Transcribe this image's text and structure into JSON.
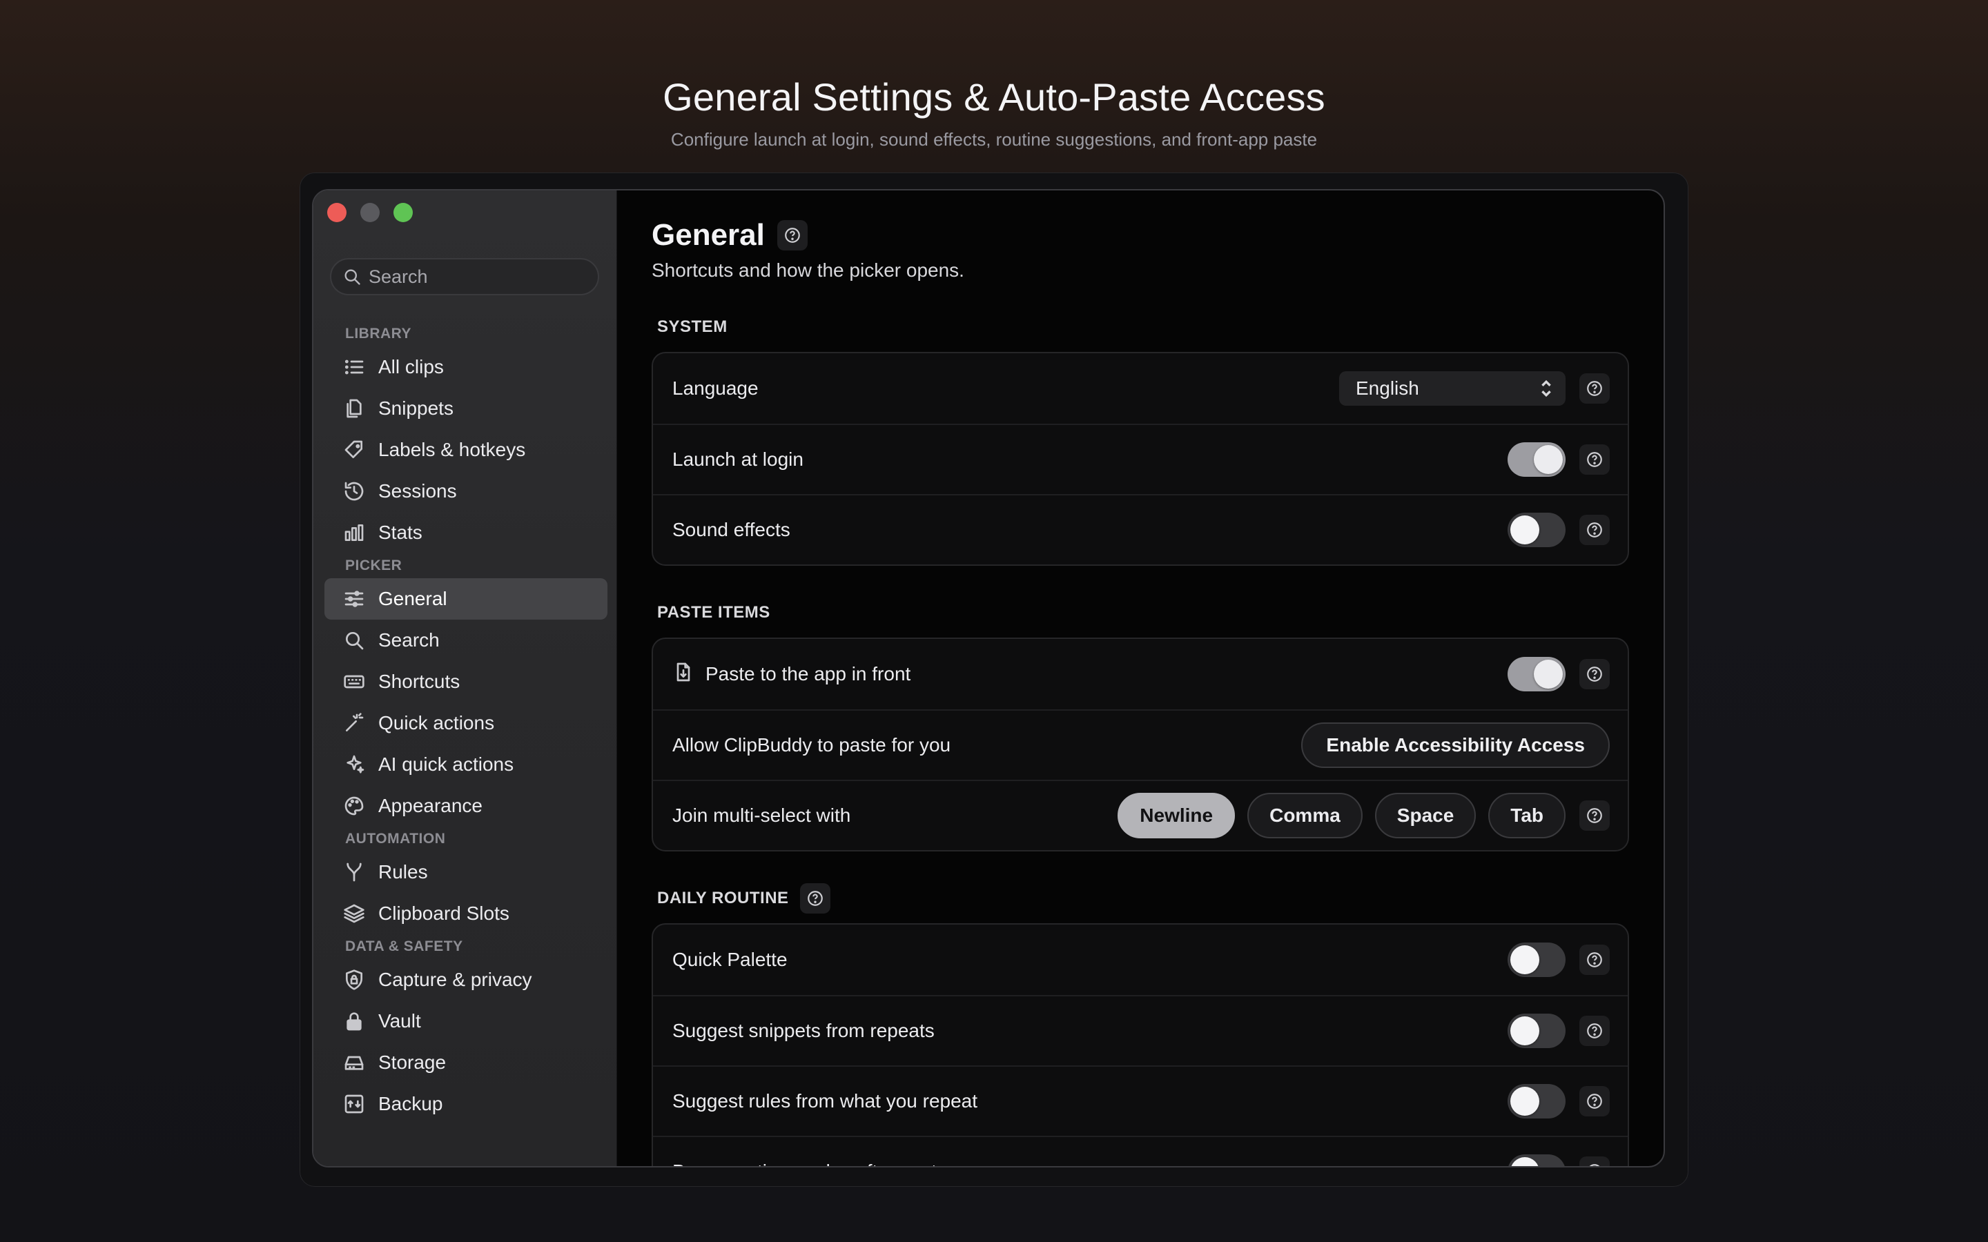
{
  "hero": {
    "title": "General Settings & Auto-Paste Access",
    "subtitle": "Configure launch at login, sound effects, routine suggestions, and front-app paste"
  },
  "sidebar": {
    "search_placeholder": "Search",
    "sections": [
      {
        "label": "LIBRARY",
        "items": [
          {
            "label": "All clips",
            "icon": "list-icon"
          },
          {
            "label": "Snippets",
            "icon": "documents-icon"
          },
          {
            "label": "Labels & hotkeys",
            "icon": "tag-icon"
          },
          {
            "label": "Sessions",
            "icon": "history-icon"
          },
          {
            "label": "Stats",
            "icon": "bar-chart-icon"
          }
        ]
      },
      {
        "label": "PICKER",
        "items": [
          {
            "label": "General",
            "icon": "sliders-icon",
            "active": true
          },
          {
            "label": "Search",
            "icon": "search-icon"
          },
          {
            "label": "Shortcuts",
            "icon": "keyboard-icon"
          },
          {
            "label": "Quick actions",
            "icon": "magic-wand-icon"
          },
          {
            "label": "AI quick actions",
            "icon": "sparkles-icon"
          },
          {
            "label": "Appearance",
            "icon": "palette-icon"
          }
        ]
      },
      {
        "label": "AUTOMATION",
        "items": [
          {
            "label": "Rules",
            "icon": "branch-icon"
          },
          {
            "label": "Clipboard Slots",
            "icon": "layers-icon"
          }
        ]
      },
      {
        "label": "DATA & SAFETY",
        "items": [
          {
            "label": "Capture & privacy",
            "icon": "shield-lock-icon"
          },
          {
            "label": "Vault",
            "icon": "lock-icon"
          },
          {
            "label": "Storage",
            "icon": "drive-icon"
          },
          {
            "label": "Backup",
            "icon": "backup-icon"
          }
        ]
      }
    ]
  },
  "main": {
    "title": "General",
    "subtitle": "Shortcuts and how the picker opens.",
    "system": {
      "label": "SYSTEM",
      "language_label": "Language",
      "language_value": "English",
      "launch_label": "Launch at login",
      "launch_on": true,
      "sound_label": "Sound effects",
      "sound_on": false
    },
    "paste": {
      "label": "PASTE ITEMS",
      "front_label": "Paste to the app in front",
      "front_on": true,
      "allow_label": "Allow ClipBuddy to paste for you",
      "allow_button": "Enable Accessibility Access",
      "join_label": "Join multi-select with",
      "join_options": [
        "Newline",
        "Comma",
        "Space",
        "Tab"
      ],
      "join_selected": "Newline"
    },
    "routine": {
      "label": "DAILY ROUTINE",
      "rows": [
        {
          "label": "Quick Palette",
          "on": false
        },
        {
          "label": "Suggest snippets from repeats",
          "on": false
        },
        {
          "label": "Suggest rules from what you repeat",
          "on": false
        },
        {
          "label": "Burn one-time codes after paste",
          "on": false
        }
      ]
    }
  },
  "colors": {
    "toggle_on": "#9d9da2",
    "toggle_off": "#3a3a3d",
    "close": "#ee5c57",
    "zoom": "#5fc454"
  }
}
